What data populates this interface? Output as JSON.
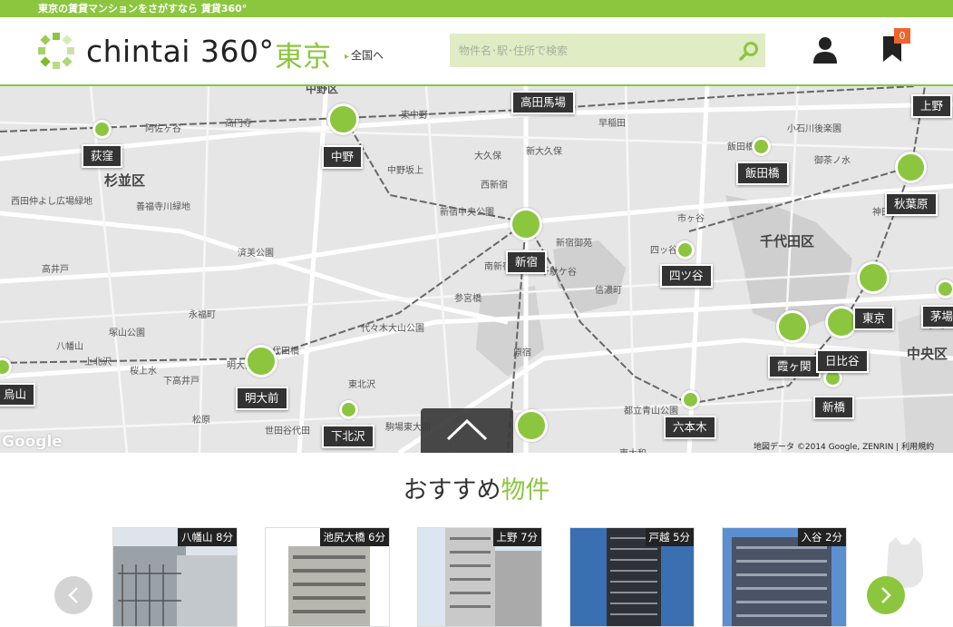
{
  "topbar": {
    "text": "東京の賃貸マンションをさがすなら 賃貸360°"
  },
  "header": {
    "logo_text": "chintai 360°",
    "city": "東京",
    "nation_link": "全国へ",
    "search_placeholder": "物件名･駅･住所で検索",
    "favorites_count": "0"
  },
  "map": {
    "area_labels": [
      "杉並区",
      "千代田区",
      "中央区",
      "中野区"
    ],
    "place_labels": [
      "西田仲よし広場緑地",
      "善福寺川緑地",
      "済美公園",
      "塚山公園",
      "高井戸",
      "阿佐ヶ谷",
      "高円寺",
      "新宿中央公園",
      "新宿御苑",
      "代々木大山公園",
      "都立青山公園",
      "小石川後楽園",
      "飯田橋",
      "永福町",
      "代田橋",
      "明大前",
      "松原",
      "世田谷代田",
      "東北沢",
      "新大久保",
      "大久保",
      "西新宿",
      "東中野",
      "中野坂上",
      "市ヶ谷",
      "四ッ谷",
      "御茶ノ水",
      "早稲田",
      "参宮橋",
      "原宿",
      "八幡山",
      "上北沢",
      "桜上水",
      "下高井戸",
      "駒場東大前",
      "東大和",
      "南新宿",
      "千駄ケ谷",
      "信濃町",
      "茅場",
      "神田"
    ],
    "stations": [
      "荻窪",
      "中野",
      "高田馬場",
      "上野",
      "飯田橋",
      "秋葉原",
      "新宿",
      "四ツ谷",
      "千代田区",
      "東京",
      "茅場",
      "明大前",
      "霞ヶ関",
      "日比谷",
      "新橋",
      "六本木",
      "下北沢",
      "烏山"
    ],
    "credit": "地図データ ©2014 Google, ZENRIN | 利用規約",
    "google": "Google"
  },
  "section": {
    "title_a": "おすすめ",
    "title_b": "物件"
  },
  "cards": [
    {
      "tag": "八幡山 8分"
    },
    {
      "tag": "池尻大橋 6分"
    },
    {
      "tag": "上野 7分"
    },
    {
      "tag": "戸越 5分"
    },
    {
      "tag": "入谷 2分"
    }
  ],
  "colors": {
    "accent": "#8cc63f",
    "badge": "#f0642b",
    "station_bg": "#333333"
  },
  "icons": [
    "search-icon",
    "user-icon",
    "bookmark-icon",
    "chevron-up-icon",
    "chevron-left-icon",
    "chevron-right-icon"
  ]
}
